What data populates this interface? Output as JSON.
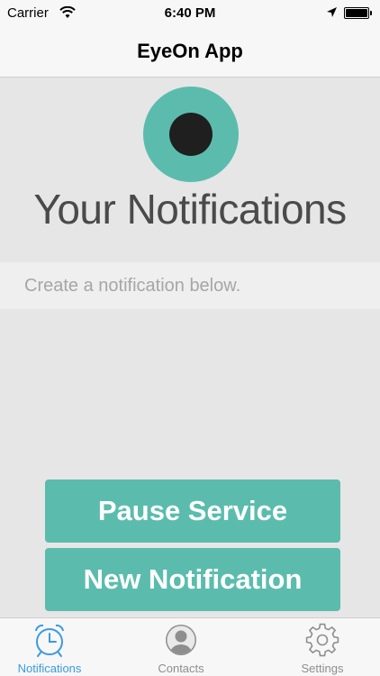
{
  "status_bar": {
    "carrier": "Carrier",
    "time": "6:40 PM"
  },
  "nav_bar": {
    "title": "EyeOn App"
  },
  "logo": {
    "icon": "eye-icon",
    "ring_color": "#5bbcad",
    "pupil_color": "#1f1f1f"
  },
  "main": {
    "heading": "Your Notifications",
    "hint": "Create a notification below."
  },
  "buttons": {
    "pause_label": "Pause Service",
    "new_label": "New Notification",
    "color": "#5bbcad"
  },
  "tab_bar": {
    "items": [
      {
        "label": "Notifications",
        "icon": "alarm-clock-icon",
        "active": true
      },
      {
        "label": "Contacts",
        "icon": "contact-avatar-icon",
        "active": false
      },
      {
        "label": "Settings",
        "icon": "gear-icon",
        "active": false
      }
    ],
    "active_color": "#3b9ae1",
    "inactive_color": "#8e8e8e"
  }
}
